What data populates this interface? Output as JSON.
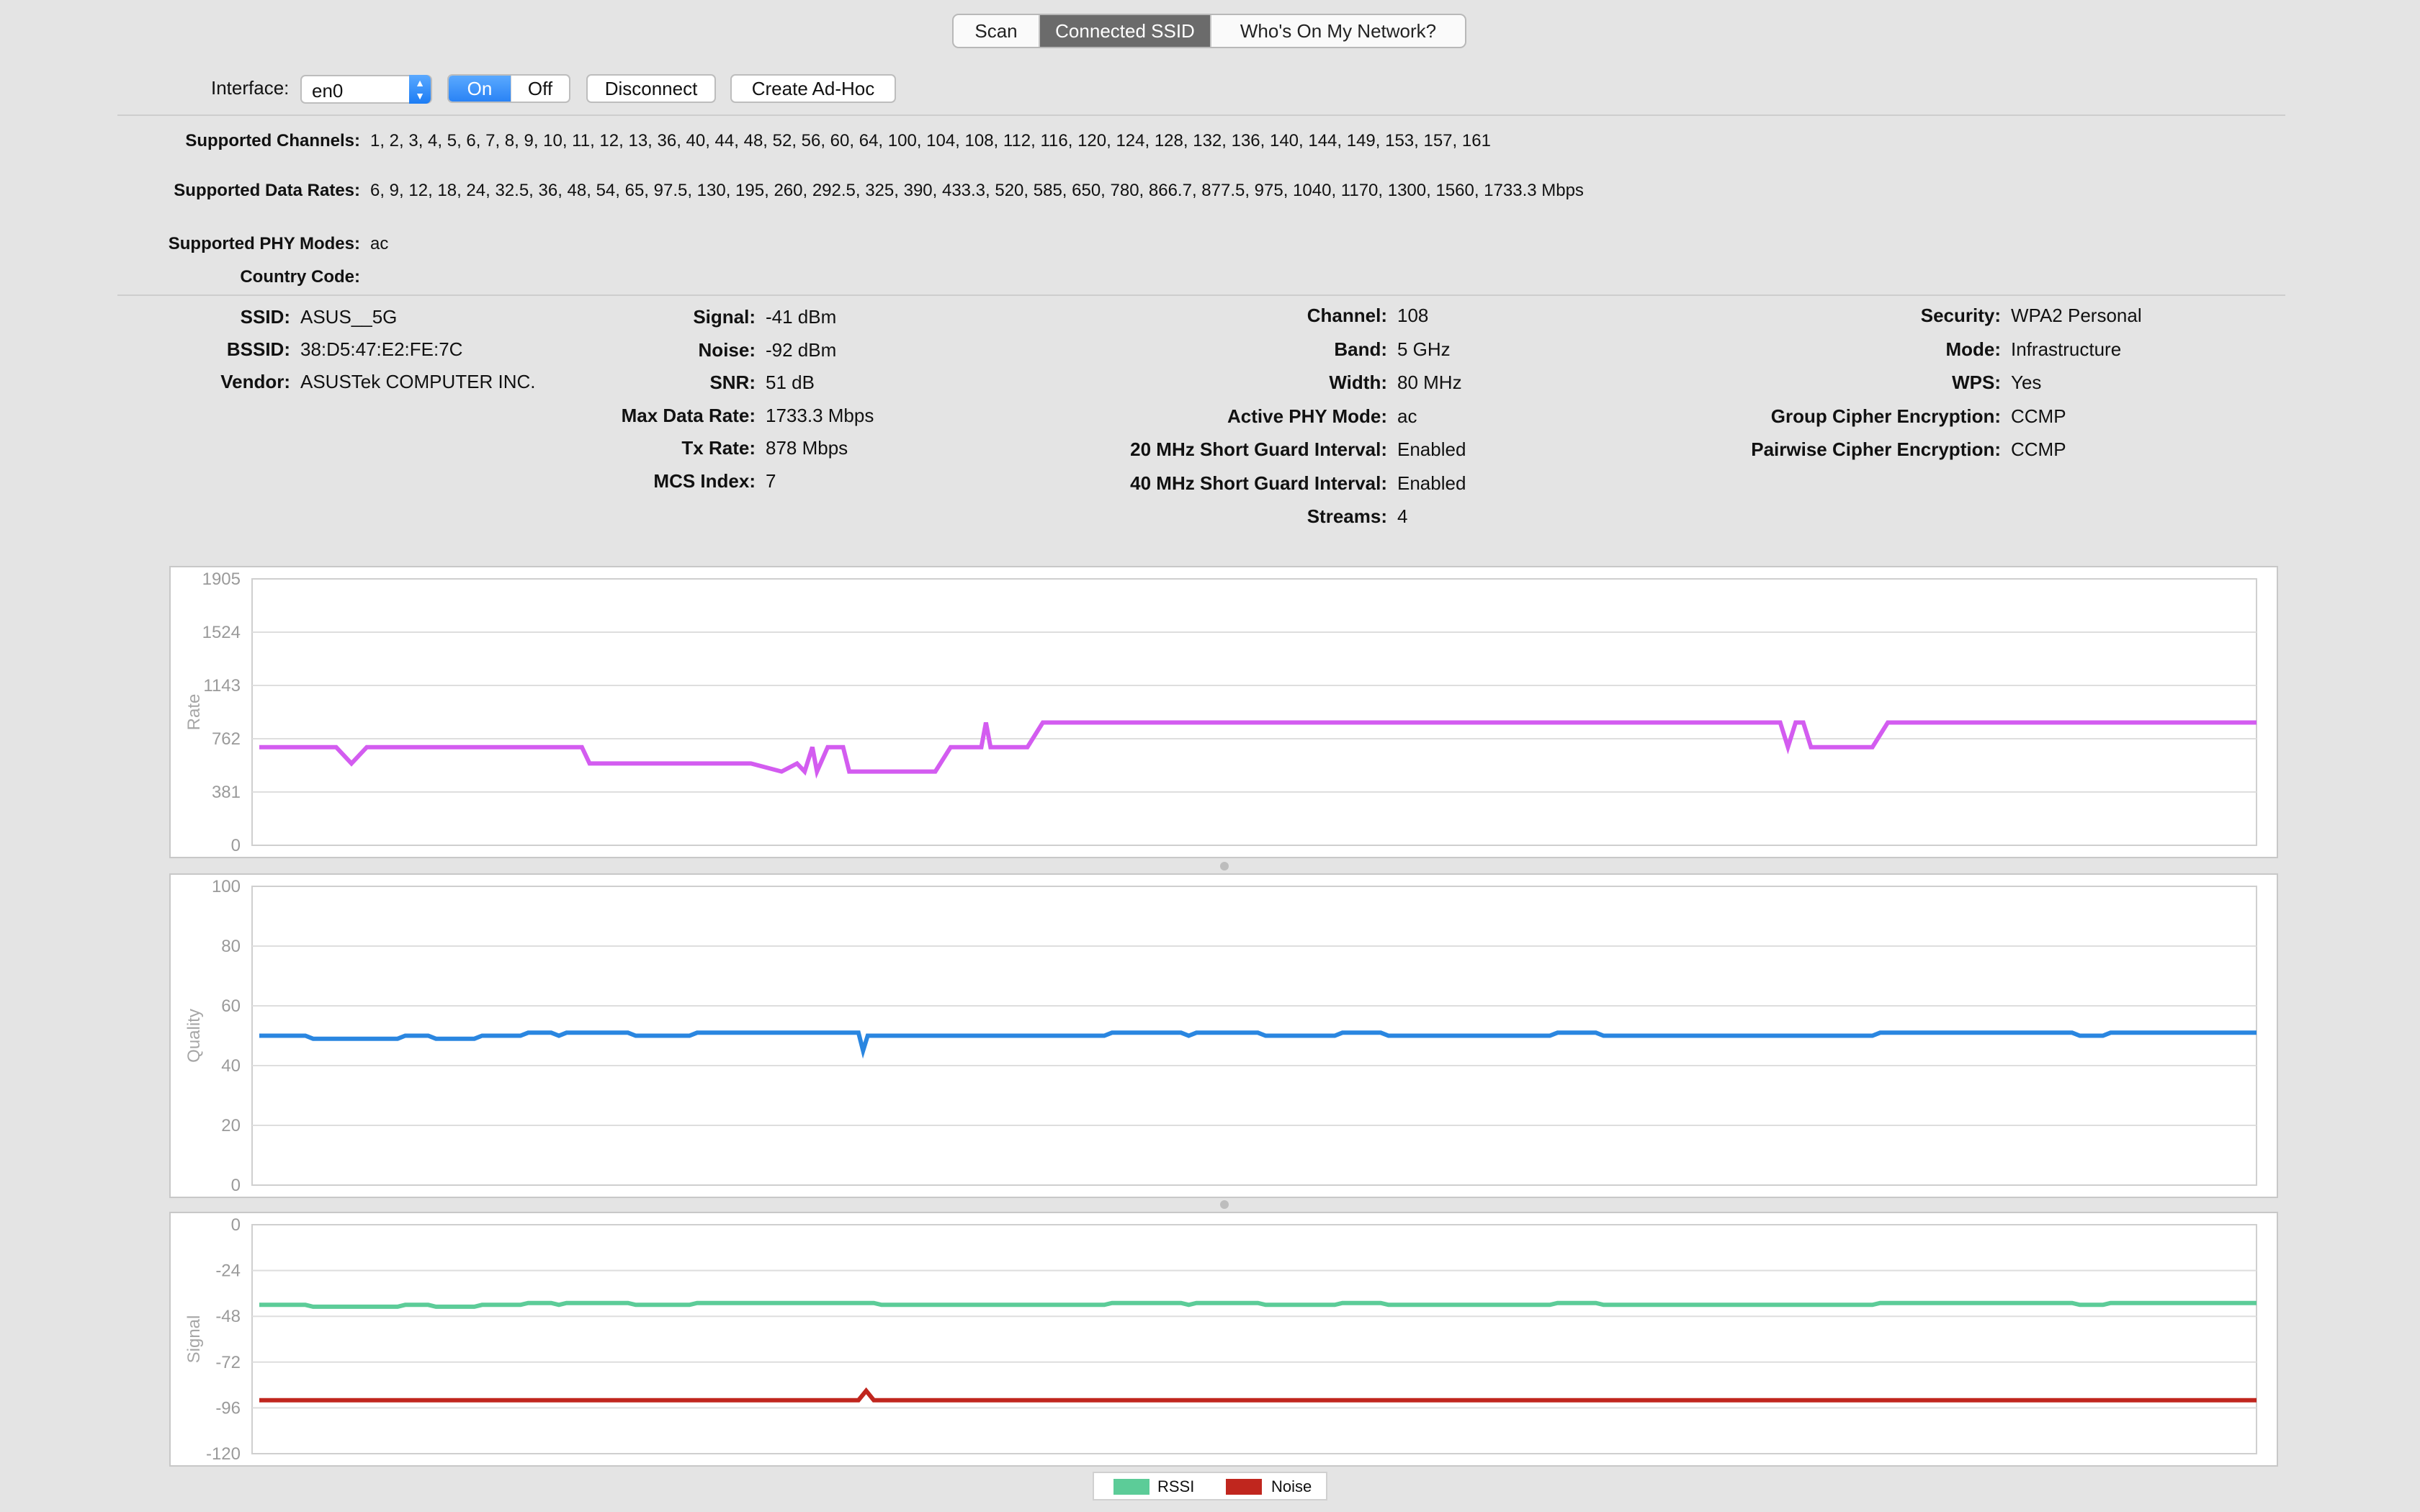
{
  "tabs": [
    {
      "label": "Scan",
      "active": false
    },
    {
      "label": "Connected SSID",
      "active": true
    },
    {
      "label": "Who's On My Network?",
      "active": false
    }
  ],
  "toolbar": {
    "interface_label": "Interface:",
    "interface_value": "en0",
    "on_label": "On",
    "off_label": "Off",
    "disconnect_label": "Disconnect",
    "adhoc_label": "Create Ad-Hoc"
  },
  "supported": {
    "channels_label": "Supported Channels:",
    "channels": "1, 2, 3, 4, 5, 6, 7, 8, 9, 10, 11, 12, 13, 36, 40, 44, 48, 52, 56, 60, 64, 100, 104, 108, 112, 116, 120, 124, 128, 132, 136, 140, 144, 149, 153, 157, 161",
    "rates_label": "Supported Data Rates:",
    "rates": "6, 9, 12, 18, 24, 32.5, 36, 48, 54, 65, 97.5, 130, 195, 260, 292.5, 325, 390, 433.3, 520, 585, 650, 780, 866.7, 877.5, 975, 1040, 1170, 1300, 1560, 1733.3 Mbps",
    "phy_label": "Supported PHY Modes:",
    "phy": "ac",
    "country_label": "Country Code:",
    "country": ""
  },
  "details": {
    "col1": [
      {
        "k": "SSID:",
        "v": "ASUS__5G"
      },
      {
        "k": "BSSID:",
        "v": "38:D5:47:E2:FE:7C"
      },
      {
        "k": "Vendor:",
        "v": "ASUSTek COMPUTER INC."
      }
    ],
    "col2": [
      {
        "k": "Signal:",
        "v": "-41 dBm"
      },
      {
        "k": "Noise:",
        "v": "-92 dBm"
      },
      {
        "k": "SNR:",
        "v": "51 dB"
      },
      {
        "k": "Max Data Rate:",
        "v": "1733.3 Mbps"
      },
      {
        "k": "Tx Rate:",
        "v": "878 Mbps"
      },
      {
        "k": "MCS Index:",
        "v": "7"
      }
    ],
    "col3": [
      {
        "k": "Channel:",
        "v": "108"
      },
      {
        "k": "Band:",
        "v": "5 GHz"
      },
      {
        "k": "Width:",
        "v": "80 MHz"
      },
      {
        "k": "Active PHY Mode:",
        "v": "ac"
      },
      {
        "k": "20 MHz Short Guard Interval:",
        "v": "Enabled"
      },
      {
        "k": "40 MHz Short Guard Interval:",
        "v": "Enabled"
      },
      {
        "k": "Streams:",
        "v": "4"
      }
    ],
    "col4": [
      {
        "k": "Security:",
        "v": "WPA2 Personal"
      },
      {
        "k": "Mode:",
        "v": "Infrastructure"
      },
      {
        "k": "WPS:",
        "v": "Yes"
      },
      {
        "k": "Group Cipher Encryption:",
        "v": "CCMP"
      },
      {
        "k": "Pairwise Cipher Encryption:",
        "v": "CCMP"
      }
    ]
  },
  "chart_data": [
    {
      "type": "line",
      "ylabel": "Rate",
      "ylim": [
        0,
        1905
      ],
      "yticks": [
        "0",
        "381",
        "762",
        "1143",
        "1524",
        "1905"
      ],
      "grid": true,
      "series": [
        {
          "color": "#d35cf0",
          "points": [
            [
              0,
              702
            ],
            [
              5,
              702
            ],
            [
              6,
              585
            ],
            [
              7,
              702
            ],
            [
              21,
              702
            ],
            [
              21.5,
              585
            ],
            [
              32,
              585
            ],
            [
              34,
              527
            ],
            [
              35,
              585
            ],
            [
              35.5,
              527
            ],
            [
              36,
              702
            ],
            [
              36.3,
              527
            ],
            [
              37,
              702
            ],
            [
              38,
              702
            ],
            [
              38.4,
              527
            ],
            [
              44,
              527
            ],
            [
              45,
              702
            ],
            [
              47,
              702
            ],
            [
              47.3,
              878
            ],
            [
              47.6,
              702
            ],
            [
              50,
              702
            ],
            [
              51,
              878
            ],
            [
              99,
              878
            ],
            [
              99.5,
              702
            ],
            [
              100,
              878
            ],
            [
              100.5,
              878
            ],
            [
              101,
              702
            ],
            [
              105,
              702
            ],
            [
              106,
              878
            ],
            [
              130,
              878
            ]
          ]
        }
      ]
    },
    {
      "type": "line",
      "ylabel": "Quality",
      "ylim": [
        0,
        100
      ],
      "yticks": [
        "0",
        "20",
        "40",
        "60",
        "80",
        "100"
      ],
      "grid": true,
      "series": [
        {
          "color": "#2a86e0",
          "points": [
            [
              0,
              50
            ],
            [
              3,
              50
            ],
            [
              3.5,
              49
            ],
            [
              9,
              49
            ],
            [
              9.5,
              50
            ],
            [
              11,
              50
            ],
            [
              11.5,
              49
            ],
            [
              14,
              49
            ],
            [
              14.5,
              50
            ],
            [
              17,
              50
            ],
            [
              17.5,
              51
            ],
            [
              19,
              51
            ],
            [
              19.5,
              50
            ],
            [
              20,
              51
            ],
            [
              24,
              51
            ],
            [
              24.5,
              50
            ],
            [
              28,
              50
            ],
            [
              28.5,
              51
            ],
            [
              39,
              51
            ],
            [
              39.3,
              45
            ],
            [
              39.6,
              50
            ],
            [
              55,
              50
            ],
            [
              55.5,
              51
            ],
            [
              60,
              51
            ],
            [
              60.5,
              50
            ],
            [
              61,
              51
            ],
            [
              65,
              51
            ],
            [
              65.5,
              50
            ],
            [
              70,
              50
            ],
            [
              70.5,
              51
            ],
            [
              73,
              51
            ],
            [
              73.5,
              50
            ],
            [
              84,
              50
            ],
            [
              84.5,
              51
            ],
            [
              87,
              51
            ],
            [
              87.5,
              50
            ],
            [
              105,
              50
            ],
            [
              105.5,
              51
            ],
            [
              118,
              51
            ],
            [
              118.5,
              50
            ],
            [
              120,
              50
            ],
            [
              120.5,
              51
            ],
            [
              130,
              51
            ]
          ]
        }
      ]
    },
    {
      "type": "line",
      "ylabel": "Signal",
      "ylim": [
        -120,
        0
      ],
      "yticks": [
        "-120",
        "-96",
        "-72",
        "-48",
        "-24",
        "0"
      ],
      "grid": true,
      "legend": "bottom-center",
      "series": [
        {
          "name": "RSSI",
          "color": "#5ccc98",
          "points": [
            [
              0,
              -42
            ],
            [
              3,
              -42
            ],
            [
              3.5,
              -43
            ],
            [
              9,
              -43
            ],
            [
              9.5,
              -42
            ],
            [
              11,
              -42
            ],
            [
              11.5,
              -43
            ],
            [
              14,
              -43
            ],
            [
              14.5,
              -42
            ],
            [
              17,
              -42
            ],
            [
              17.5,
              -41
            ],
            [
              19,
              -41
            ],
            [
              19.5,
              -42
            ],
            [
              20,
              -41
            ],
            [
              24,
              -41
            ],
            [
              24.5,
              -42
            ],
            [
              28,
              -42
            ],
            [
              28.5,
              -41
            ],
            [
              40,
              -41
            ],
            [
              40.5,
              -42
            ],
            [
              55,
              -42
            ],
            [
              55.5,
              -41
            ],
            [
              60,
              -41
            ],
            [
              60.5,
              -42
            ],
            [
              61,
              -41
            ],
            [
              65,
              -41
            ],
            [
              65.5,
              -42
            ],
            [
              70,
              -42
            ],
            [
              70.5,
              -41
            ],
            [
              73,
              -41
            ],
            [
              73.5,
              -42
            ],
            [
              84,
              -42
            ],
            [
              84.5,
              -41
            ],
            [
              87,
              -41
            ],
            [
              87.5,
              -42
            ],
            [
              105,
              -42
            ],
            [
              105.5,
              -41
            ],
            [
              118,
              -41
            ],
            [
              118.5,
              -42
            ],
            [
              120,
              -42
            ],
            [
              120.5,
              -41
            ],
            [
              130,
              -41
            ]
          ]
        },
        {
          "name": "Noise",
          "color": "#c0261e",
          "points": [
            [
              0,
              -92
            ],
            [
              39,
              -92
            ],
            [
              39.5,
              -87
            ],
            [
              40,
              -92
            ],
            [
              130,
              -92
            ]
          ]
        }
      ]
    }
  ]
}
